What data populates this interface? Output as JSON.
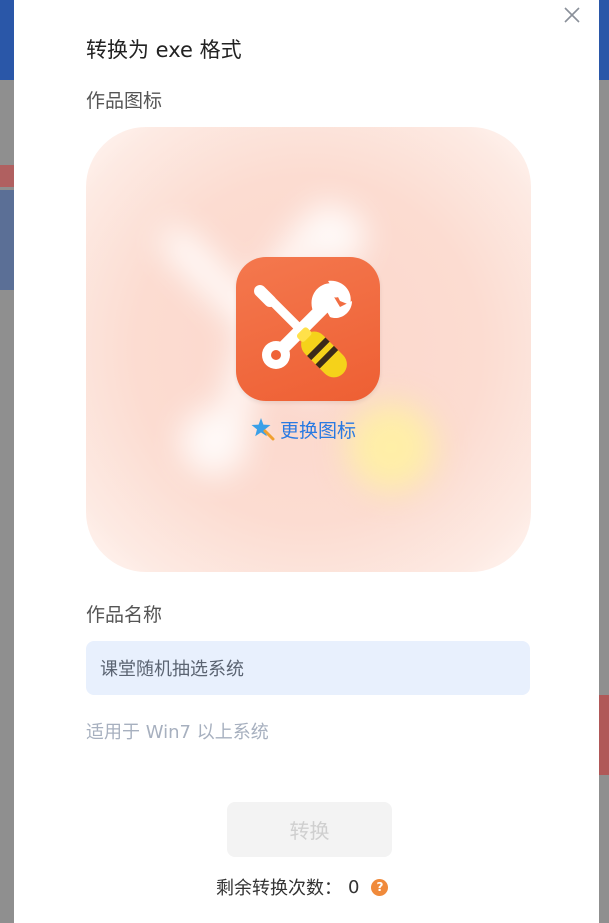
{
  "dialog": {
    "title": "转换为 exe 格式",
    "icon_section_label": "作品图标",
    "change_icon_label": "更换图标",
    "name_section_label": "作品名称",
    "name_value": "课堂随机抽选系统",
    "hint": "适用于 Win7 以上系统",
    "convert_label": "转换",
    "remaining_label": "剩余转换次数：",
    "remaining_count": "0",
    "help_glyph": "?"
  },
  "icons": {
    "close": "close-icon",
    "app": "tools-wrench-screwdriver-icon",
    "change": "magic-star-icon",
    "help": "question-icon"
  },
  "colors": {
    "accent": "#2a7ae2",
    "app_icon": "#ee5f33",
    "input_bg": "#e8f0fd",
    "help_badge": "#f08a3b"
  }
}
